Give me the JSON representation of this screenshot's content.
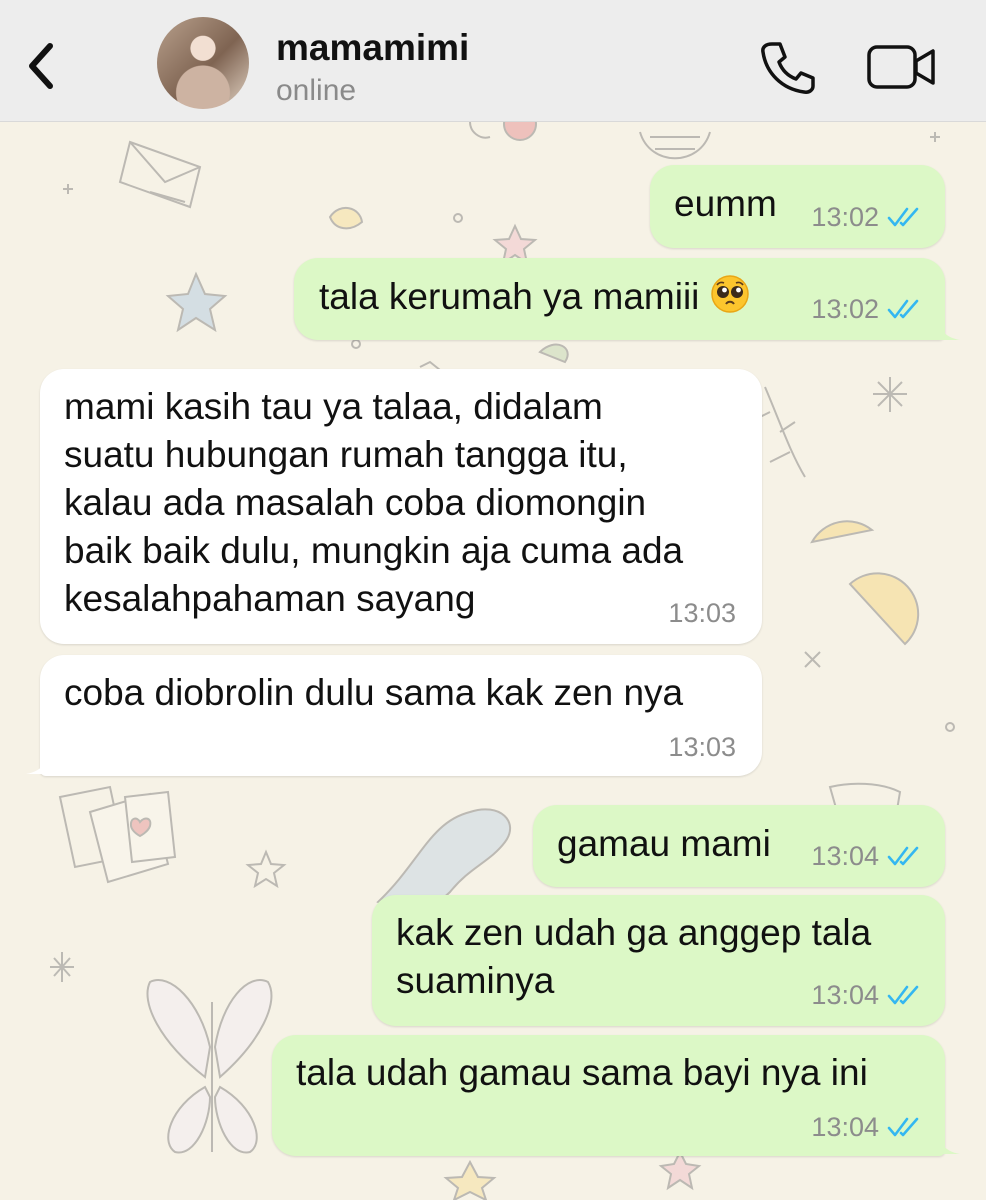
{
  "header": {
    "contact_name": "mamamimi",
    "status": "online"
  },
  "colors": {
    "outgoing_bubble": "#dcf8c6",
    "incoming_bubble": "#ffffff",
    "read_ticks": "#34b7f1",
    "header_bg": "#ededed"
  },
  "icons": [
    "back-chevron-icon",
    "avatar",
    "phone-call-icon",
    "video-call-icon",
    "double-check-read-icon",
    "pleading-face-emoji"
  ],
  "messages": [
    {
      "direction": "outgoing",
      "text": "eumm",
      "time": "13:02",
      "status": "read"
    },
    {
      "direction": "outgoing",
      "text": "tala kerumah ya mamiii",
      "emoji": "pleading-face",
      "time": "13:02",
      "status": "read"
    },
    {
      "direction": "incoming",
      "lines": [
        "mami kasih tau ya talaa, didalam",
        "suatu hubungan rumah tangga itu,",
        "kalau ada masalah coba diomongin",
        "baik baik dulu, mungkin aja cuma ada",
        "kesalahpahaman sayang"
      ],
      "time": "13:03"
    },
    {
      "direction": "incoming",
      "text": "coba diobrolin dulu sama kak zen nya",
      "time": "13:03"
    },
    {
      "direction": "outgoing",
      "text": "gamau mami",
      "time": "13:04",
      "status": "read"
    },
    {
      "direction": "outgoing",
      "lines": [
        "kak zen udah ga anggep tala",
        "suaminya"
      ],
      "time": "13:04",
      "status": "read"
    },
    {
      "direction": "outgoing",
      "text": "tala udah gamau sama bayi nya ini",
      "time": "13:04",
      "status": "read"
    }
  ]
}
